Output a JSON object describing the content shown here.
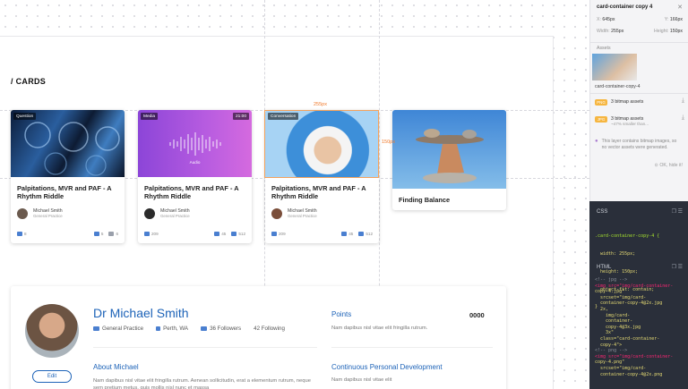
{
  "section": {
    "title": "/ CARDS"
  },
  "selection": {
    "width_label": "255px",
    "height_label": "150px"
  },
  "cards": [
    {
      "badge": "Question",
      "duration": "",
      "title": "Palpitations, MVR and PAF - A Rhythm Riddle",
      "author": "Michael Smith",
      "role": "General Practice",
      "likes": "8",
      "comments": "5",
      "views": "6"
    },
    {
      "badge": "Media",
      "duration": "21:00",
      "audio_label": "Audio",
      "title": "Palpitations, MVR and PAF - A Rhythm Riddle",
      "author": "Michael Smith",
      "role": "General Practice",
      "likes": "209",
      "comments": "45",
      "views": "512"
    },
    {
      "badge": "Conversation",
      "duration": "",
      "title": "Palpitations, MVR and PAF - A Rhythm Riddle",
      "author": "Michael Smith",
      "role": "General Practice",
      "likes": "209",
      "comments": "45",
      "views": "512"
    },
    {
      "badge": "",
      "duration": "",
      "title": "Finding Balance"
    }
  ],
  "profile": {
    "name": "Dr Michael Smith",
    "specialty": "General Practice",
    "location": "Perth, WA",
    "followers": "36 Followers",
    "following": "42 Following",
    "edit_label": "Edit",
    "about_heading": "About Michael",
    "about_text": "Nam dapibus nisl vitae elit fringilla rutrum. Aenean sollicitudin, erat a elementum rutrum, neque sem pretium metus, quis mollis nisl nunc et massa",
    "points_heading": "Points",
    "points_value": "0000",
    "points_text": "Nam dapibus nisl vitae elit fringilla rutrum.",
    "cpd_heading": "Continuous Personal Development",
    "cpd_text": "Nam dapibus nisl vitae elit"
  },
  "inspector": {
    "title": "card-container copy 4",
    "x_label": "X:",
    "x_value": "645px",
    "y_label": "Y:",
    "y_value": "166px",
    "w_label": "Width:",
    "w_value": "255px",
    "h_label": "Height:",
    "h_value": "150px",
    "assets_label": "Assets",
    "asset_name": "card-container-copy-4",
    "png_tag": "PNG",
    "png_text": "3 bitmap assets",
    "jpg_tag": "JPG",
    "jpg_text": "3 bitmap assets",
    "jpg_sub": "~47% smaller than...",
    "note": "This layer contains bitmap images, so no vector assets were generated.",
    "hide_label": "OK, hide it!"
  },
  "code": {
    "css_label": "CSS",
    "html_label": "HTML",
    "css_lines": [
      ".card-container-copy-4 {",
      "  width: 255px;",
      "  height: 150px;",
      "  object-fit: contain;",
      "}"
    ],
    "html_lines": [
      "<!-- jpg -->",
      "",
      "<img src=\"img/card-container-",
      "copy-4.jpg\"",
      "  srcset=\"img/card-",
      "  container-copy-4@2x.jpg",
      "  2x,",
      "    img/card-",
      "    container-",
      "    copy-4@3x.jpg",
      "    3x\"",
      "  class=\"card-container-",
      "  copy-4\">",
      "<!-- png -->",
      "",
      "<img src=\"img/card-container-",
      "copy-4.png\"",
      "  srcset=\"img/card-",
      "  container-copy-4@2x.png"
    ]
  }
}
